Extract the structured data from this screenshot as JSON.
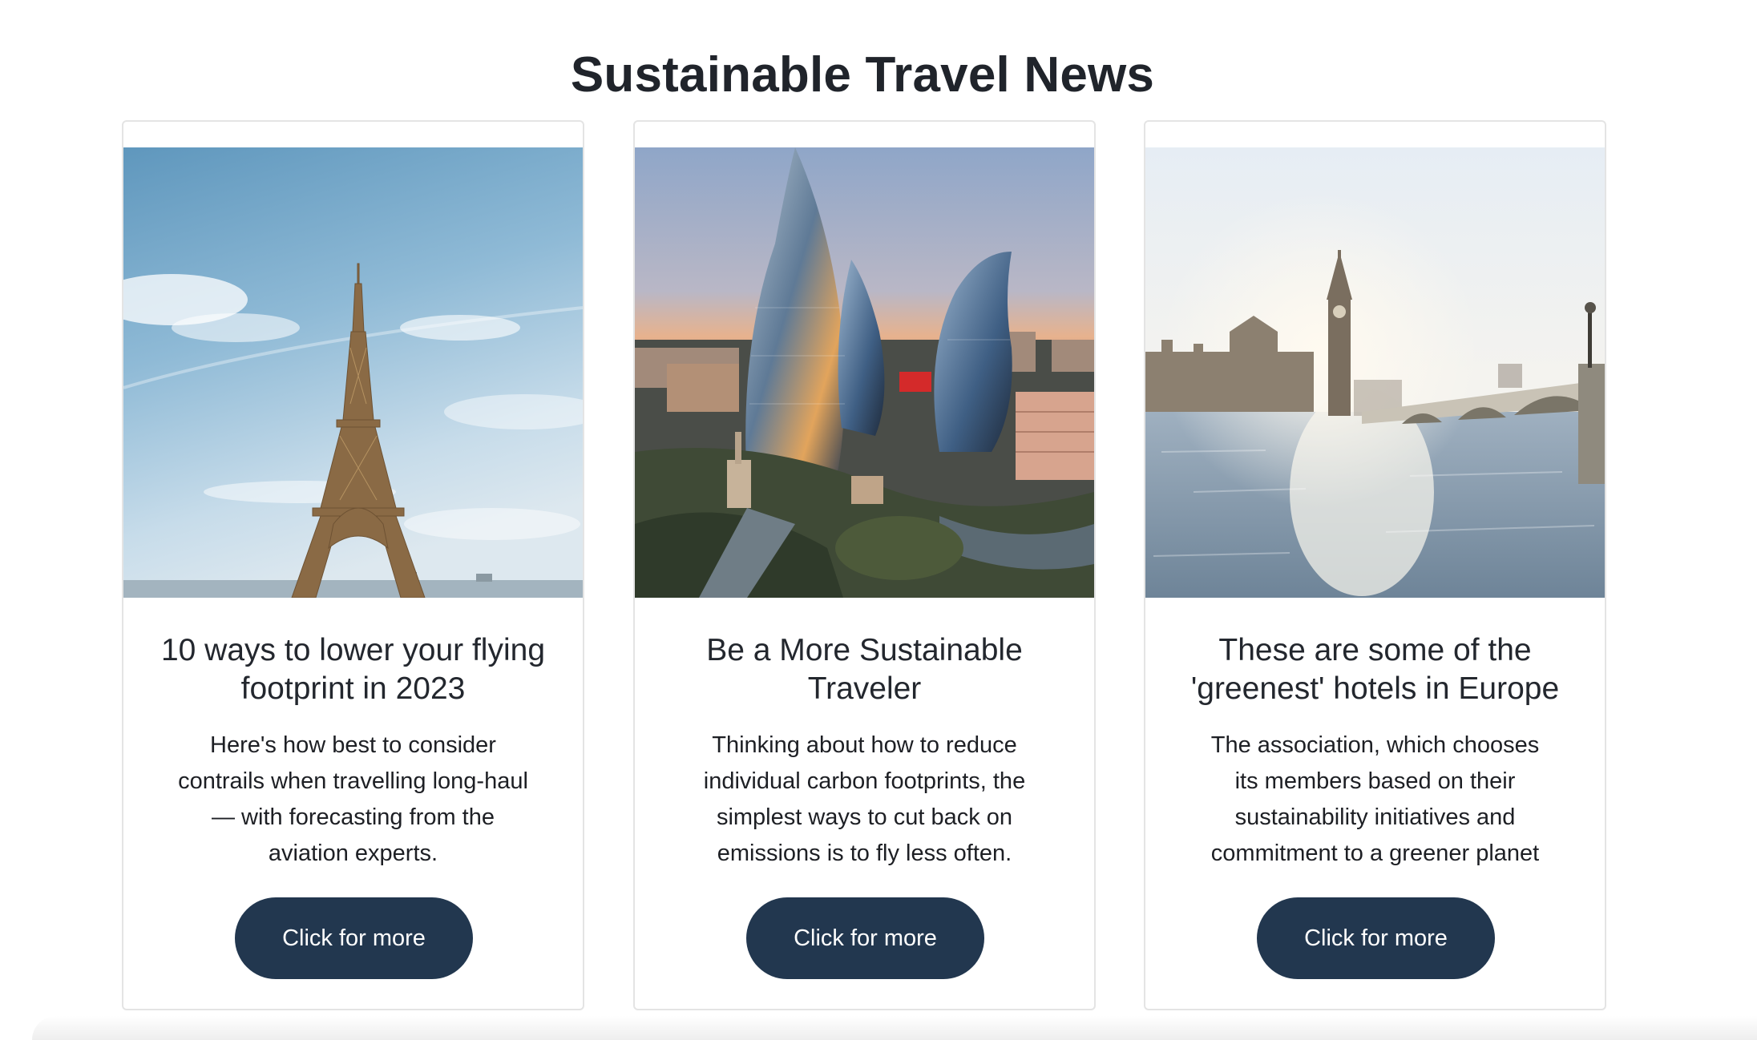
{
  "page": {
    "title": "Sustainable Travel News"
  },
  "colors": {
    "button_bg": "#22374f",
    "button_text": "#ffffff",
    "title_text": "#20242b",
    "card_border": "#e4e4e4"
  },
  "cards": [
    {
      "image_label": "eiffel-tower-photo",
      "title": "10 ways to lower your flying footprint in 2023",
      "text": "Here's how best to consider contrails when travelling long-haul — with forecasting from the aviation experts.",
      "button_label": "Click for more"
    },
    {
      "image_label": "baku-flame-towers-photo",
      "title": "Be a More Sustainable Traveler",
      "text": "Thinking about how to reduce individual carbon footprints, the simplest ways to cut back on emissions is to fly less often.",
      "button_label": "Click for more"
    },
    {
      "image_label": "london-westminster-photo",
      "title": "These are some of the 'greenest' hotels in Europe",
      "text": "The association, which chooses its members based on their sustainability initiatives and commitment to a greener planet",
      "button_label": "Click for more"
    }
  ]
}
